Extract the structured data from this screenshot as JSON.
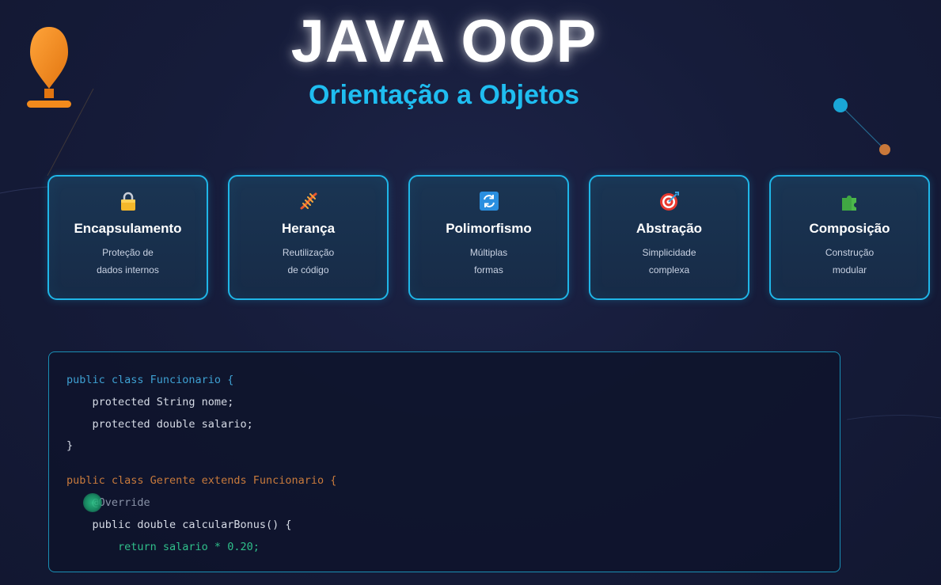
{
  "header": {
    "title": "JAVA OOP",
    "subtitle": "Orientação a Objetos"
  },
  "cards": [
    {
      "icon": "lock-icon",
      "title": "Encapsulamento",
      "desc": [
        "Proteção de",
        "dados internos"
      ]
    },
    {
      "icon": "dna-icon",
      "title": "Herança",
      "desc": [
        "Reutilização",
        "de código"
      ]
    },
    {
      "icon": "refresh-icon",
      "title": "Polimorfismo",
      "desc": [
        "Múltiplas",
        "formas"
      ]
    },
    {
      "icon": "target-icon",
      "title": "Abstração",
      "desc": [
        "Simplicidade",
        "complexa"
      ]
    },
    {
      "icon": "puzzle-icon",
      "title": "Composição",
      "desc": [
        "Construção",
        "modular"
      ]
    }
  ],
  "code": {
    "lines": [
      "public class Funcionario {",
      "    protected String nome;",
      "    protected double salario;",
      "}",
      "",
      "public class Gerente extends Funcionario {",
      "    @Override",
      "    public double calcularBonus() {",
      "        return salario * 0.20;"
    ]
  },
  "colors": {
    "accent": "#1fbdf0",
    "card_border": "#1fb6e8",
    "orange": "#f28a1c",
    "code_green": "#2fbf8a"
  }
}
